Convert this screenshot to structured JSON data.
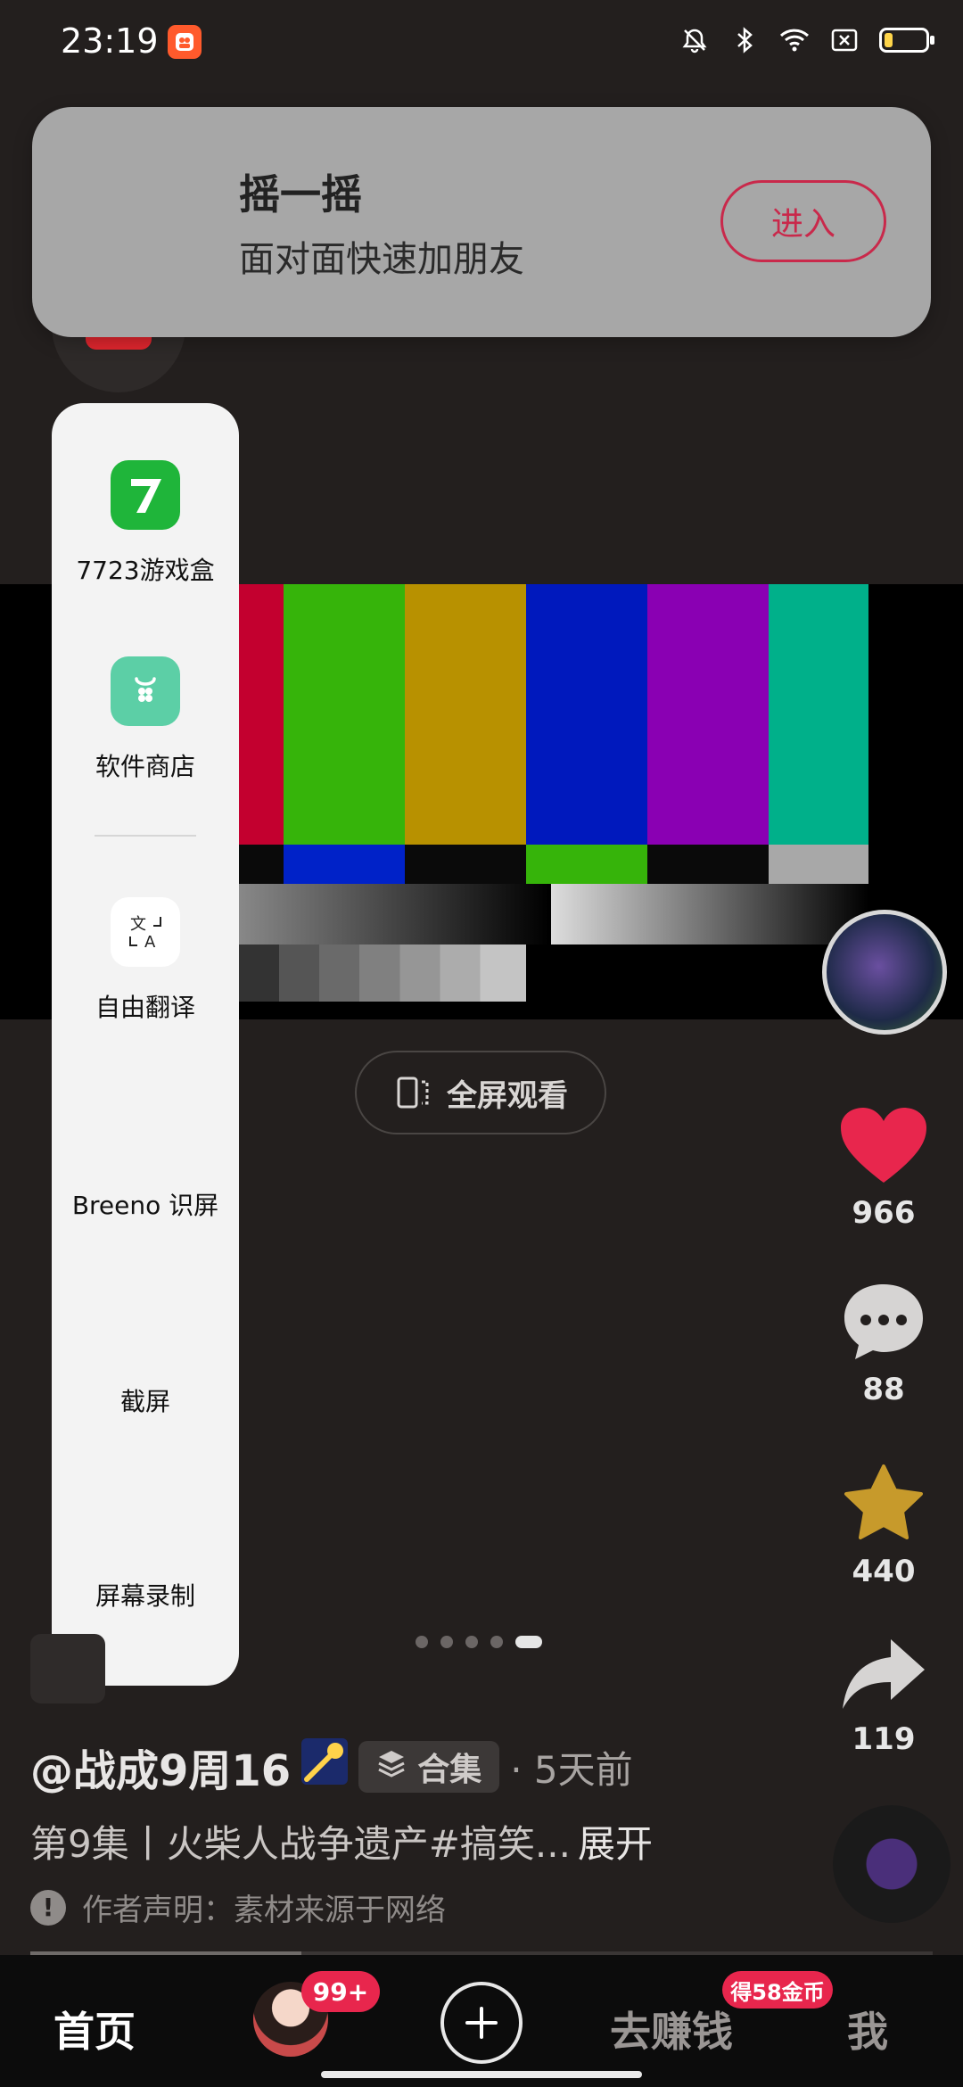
{
  "status_bar": {
    "time": "23:19",
    "app_icon": "kuaishou-icon",
    "icons": [
      "mute-bell-icon",
      "bluetooth-icon",
      "wifi-icon",
      "no-sim-icon",
      "battery-icon"
    ],
    "battery_level": 0.18
  },
  "banner": {
    "title": "摇一摇",
    "subtitle": "面对面快速加朋友",
    "enter_label": "进入"
  },
  "side_panel": {
    "items": [
      {
        "label": "7723游戏盒",
        "icon": "game-box-icon"
      },
      {
        "label": "软件商店",
        "icon": "app-store-icon"
      },
      {
        "label": "自由翻译",
        "icon": "translate-icon"
      },
      {
        "label": "Breeno 识屏",
        "icon": "breeno-icon"
      },
      {
        "label": "截屏",
        "icon": "screenshot-icon"
      },
      {
        "label": "屏幕录制",
        "icon": "screen-record-icon"
      }
    ]
  },
  "video": {
    "fullscreen_label": "全屏观看"
  },
  "actions": {
    "like_count": "966",
    "comment_count": "88",
    "favorite_count": "440",
    "share_count": "119"
  },
  "carousel": {
    "total": 5,
    "active": 5
  },
  "post": {
    "author": "@战成9周16",
    "collection_label": "合集",
    "time_ago": "· 5天前",
    "description": "第9集丨火柴人战争遗产#搞笑...",
    "expand_label": "展开",
    "notice": "作者声明：素材来源于网络",
    "progress": 0.3
  },
  "nav": {
    "home": "首页",
    "friends_badge": "99+",
    "earn": "去赚钱",
    "earn_badge": "得58金币",
    "me": "我"
  },
  "colors": {
    "accent": "#e8264d",
    "background": "#231f1e",
    "banner_bg": "#a7a7a7",
    "panel_bg": "#f3f3f3"
  }
}
